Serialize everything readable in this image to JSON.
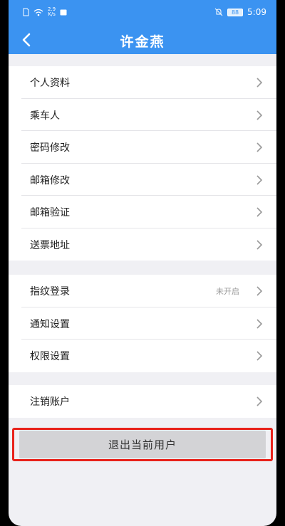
{
  "status_bar": {
    "network_speed_value": "2.9",
    "network_speed_unit": "K/s",
    "battery": "88",
    "time": "5:09"
  },
  "header": {
    "title": "许金燕"
  },
  "groups": [
    {
      "items": [
        {
          "label": "个人资料"
        },
        {
          "label": "乘车人"
        },
        {
          "label": "密码修改"
        },
        {
          "label": "邮箱修改"
        },
        {
          "label": "邮箱验证"
        },
        {
          "label": "送票地址"
        }
      ]
    },
    {
      "items": [
        {
          "label": "指纹登录",
          "status": "未开启"
        },
        {
          "label": "通知设置"
        },
        {
          "label": "权限设置"
        }
      ]
    },
    {
      "items": [
        {
          "label": "注销账户"
        }
      ]
    }
  ],
  "logout": {
    "label": "退出当前用户"
  },
  "colors": {
    "accent": "#3b93f1",
    "highlight": "#e8221b",
    "background": "#f0f0f4"
  }
}
